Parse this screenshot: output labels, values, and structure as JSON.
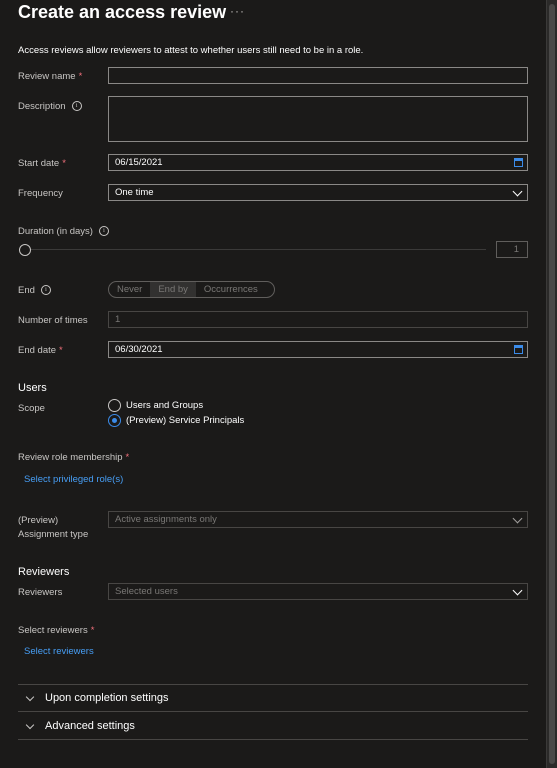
{
  "title": "Create an access review",
  "more_label": "···",
  "description_text": "Access reviews allow reviewers to attest to whether users still need to be in a role.",
  "review_name": {
    "label": "Review name",
    "required": "*",
    "value": ""
  },
  "description": {
    "label": "Description",
    "info": "i"
  },
  "start_date": {
    "label": "Start date",
    "required": "*",
    "value": "06/15/2021"
  },
  "frequency": {
    "label": "Frequency",
    "value": "One time"
  },
  "duration": {
    "label": "Duration (in days)",
    "info": "i",
    "value": "1",
    "slider_fraction": 0
  },
  "end": {
    "label": "End",
    "info": "i",
    "options": [
      "Never",
      "End by",
      "Occurrences"
    ],
    "selected": "End by"
  },
  "number_of_times": {
    "label": "Number of times",
    "value": "1"
  },
  "end_date": {
    "label": "End date",
    "required": "*",
    "value": "06/30/2021"
  },
  "users": {
    "heading": "Users",
    "scope_label": "Scope",
    "options": [
      "Users and Groups",
      "(Preview) Service Principals"
    ],
    "selected": "(Preview) Service Principals"
  },
  "review_role_membership": {
    "label": "Review role membership",
    "required": "*",
    "link": "Select privileged role(s)"
  },
  "assignment_type": {
    "label_line1": "(Preview)",
    "label_line2": "Assignment type",
    "value": "Active assignments only"
  },
  "reviewers": {
    "heading": "Reviewers",
    "label": "Reviewers",
    "value": "Selected users",
    "select_label": "Select reviewers",
    "required": "*",
    "link": "Select reviewers"
  },
  "accordions": [
    "Upon completion settings",
    "Advanced settings"
  ],
  "colors": {
    "accent": "#479ef5",
    "required": "#f1707b",
    "background": "#1b1a19"
  }
}
